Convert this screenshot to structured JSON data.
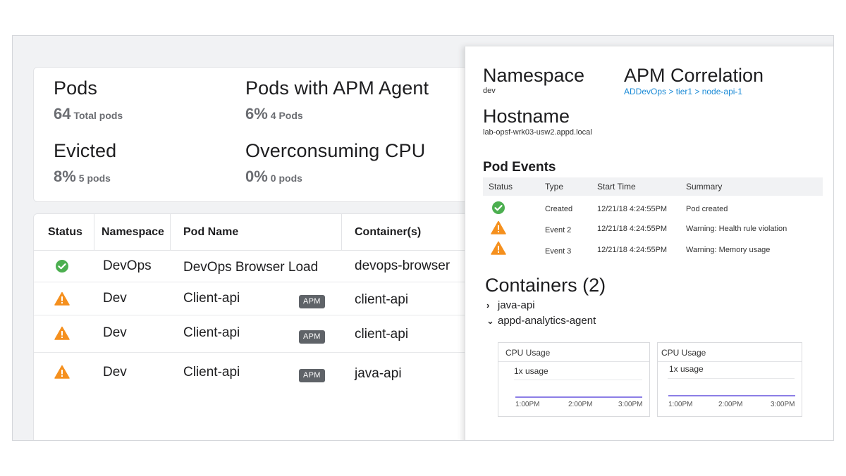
{
  "summary": {
    "pods": {
      "title": "Pods",
      "value": "64",
      "sub": "Total pods"
    },
    "pods_apm": {
      "title": "Pods with APM Agent",
      "value": "6%",
      "sub": "4 Pods"
    },
    "evicted": {
      "title": "Evicted",
      "value": "8%",
      "sub": "5 pods"
    },
    "overcpu": {
      "title": "Overconsuming CPU",
      "value": "0%",
      "sub": "0 pods"
    }
  },
  "pods_table": {
    "headers": [
      "Status",
      "Namespace",
      "Pod Name",
      "Container(s)"
    ],
    "rows": [
      {
        "status": "ok",
        "namespace": "DevOps",
        "pod": "DevOps Browser Load",
        "apm": "",
        "container": "devops-browser"
      },
      {
        "status": "warning",
        "namespace": "Dev",
        "pod": "Client-api",
        "apm": "APM",
        "container": "client-api"
      },
      {
        "status": "warning",
        "namespace": "Dev",
        "pod": "Client-api",
        "apm": "APM",
        "container": "client-api"
      },
      {
        "status": "warning",
        "namespace": "Dev",
        "pod": "Client-api",
        "apm": "APM",
        "container": "java-api"
      }
    ]
  },
  "detail": {
    "namespace_label": "Namespace",
    "namespace_value": "dev",
    "apm_label": "APM Correlation",
    "apm_link": "ADDevOps > tier1 > node-api-1",
    "hostname_label": "Hostname",
    "hostname_value": "lab-opsf-wrk03-usw2.appd.local",
    "events_title": "Pod Events",
    "events_headers": [
      "Status",
      "Type",
      "Start Time",
      "Summary"
    ],
    "events": [
      {
        "status": "ok",
        "type": "Created",
        "time": "12/21/18 4:24:55PM",
        "summary": "Pod created"
      },
      {
        "status": "warning",
        "type": "Event 2",
        "time": "12/21/18 4:24:55PM",
        "summary": "Warning: Health rule violation"
      },
      {
        "status": "warning",
        "type": "Event 3",
        "time": "12/21/18 4:24:55PM",
        "summary": "Warning: Memory usage"
      }
    ],
    "containers_title": "Containers (2)",
    "containers": [
      {
        "name": "java-api",
        "expanded": false
      },
      {
        "name": "appd-analytics-agent",
        "expanded": true
      }
    ],
    "cpu_charts": [
      {
        "title": "CPU Usage",
        "usage": "1x usage",
        "ticks": [
          "1:00PM",
          "2:00PM",
          "3:00PM"
        ]
      },
      {
        "title": "CPU Usage",
        "usage": "1x usage",
        "ticks": [
          "1:00PM",
          "2:00PM",
          "3:00PM"
        ]
      }
    ]
  },
  "colors": {
    "ok": "#4caf50",
    "warning": "#f5901e",
    "accent": "#1a8ad6",
    "chart_line": "#8c7ee6"
  },
  "icons": {
    "ok": "check-circle-icon",
    "warning": "warning-triangle-icon",
    "collapsed": "chevron-right-icon",
    "expanded": "chevron-down-icon"
  }
}
